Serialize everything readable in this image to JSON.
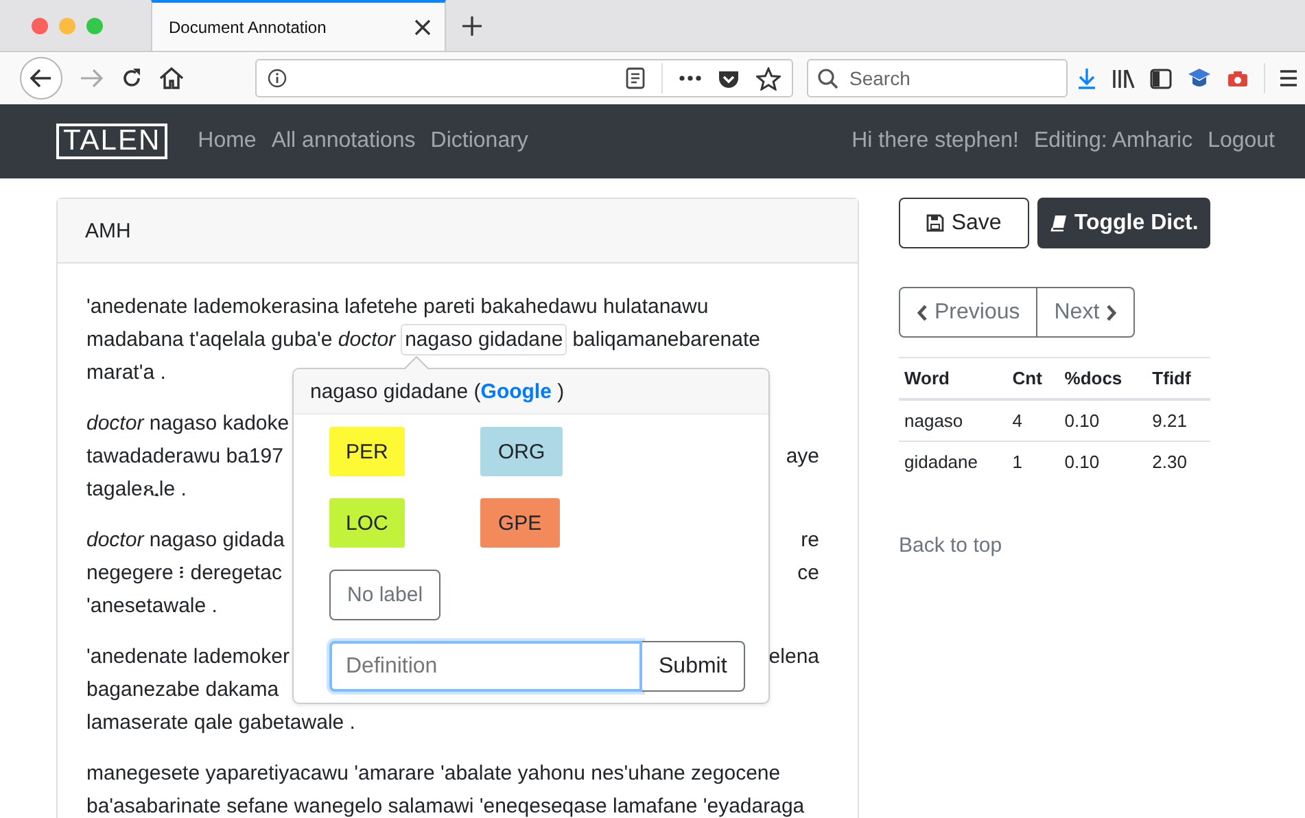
{
  "browser": {
    "tab": {
      "title": "Document Annotation",
      "selected": true
    },
    "search": {
      "placeholder": "Search"
    }
  },
  "navbar": {
    "brand": "TALEN",
    "links": [
      "Home",
      "All annotations",
      "Dictionary"
    ],
    "right": [
      "Hi there stephen!",
      "Editing: Amharic",
      "Logout"
    ]
  },
  "document": {
    "header": "AMH",
    "paragraphs": [
      [
        {
          "left": "'anedenate lademokerasina lafetehe pareti bakahedawu hulatanawu"
        },
        {
          "left": "madabana t'aqelala guba'e *doctor*",
          "selected": "nagaso gidadane",
          "after": "baliqamanebarenate"
        },
        {
          "left": "marat'a ."
        }
      ],
      [
        {
          "left": "*doctor* nagaso kadoke"
        },
        {
          "left": "tawadaderawu ba197",
          "right": "aye"
        },
        {
          "left": "tagaleጺle ."
        }
      ],
      [
        {
          "left": "*doctor* nagaso gidada",
          "right": "re"
        },
        {
          "left": "negegere ፧ deregetac",
          "right": "ce"
        },
        {
          "left": "'anesetawale ."
        }
      ],
      [
        {
          "left": "'anedenate lademoker",
          "right": "elena"
        },
        {
          "left": "baganezabe dakama"
        },
        {
          "left": "lamaserate qale gabetawale ."
        }
      ],
      [
        {
          "left": "manegesete yaparetiyacawu 'amarare 'abalate yahonu nes'uhane zegocene"
        },
        {
          "left": "ba'asabarinate sefane wanegelo salamawi 'eneqeseqase lamafane 'eyadaraga"
        }
      ]
    ]
  },
  "popover": {
    "title": "nagaso gidadane (",
    "link": "Google",
    "title_end": " )",
    "labels": [
      {
        "text": "PER",
        "color": "#fdf935"
      },
      {
        "text": "ORG",
        "color": "#add8e6"
      },
      {
        "text": "LOC",
        "color": "#c3f23b"
      },
      {
        "text": "GPE",
        "color": "#f38a5c"
      }
    ],
    "no_label": "No label",
    "definition": {
      "placeholder": "Definition"
    },
    "submit": "Submit"
  },
  "sidebar": {
    "save": "Save",
    "toggle": "Toggle Dict.",
    "previous": "Previous",
    "next": "Next",
    "table": {
      "columns": [
        "Word",
        "Cnt",
        "%docs",
        "Tfidf"
      ],
      "rows": [
        [
          "nagaso",
          "4",
          "0.10",
          "9.21"
        ],
        [
          "gidadane",
          "1",
          "0.10",
          "2.30"
        ]
      ]
    },
    "back_to_top": "Back to top"
  }
}
